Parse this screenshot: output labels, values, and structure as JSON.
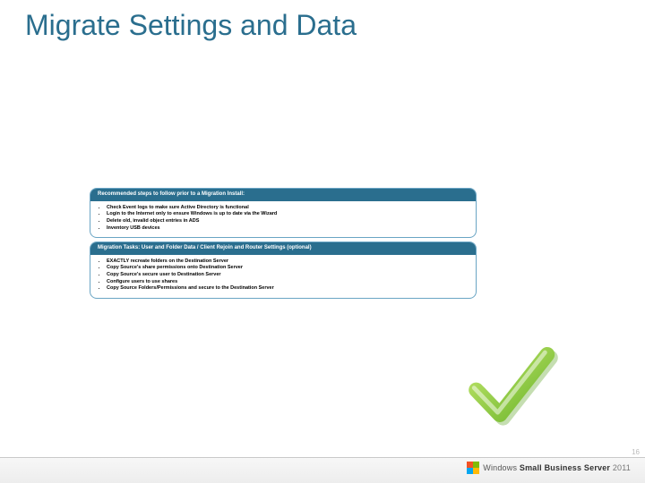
{
  "title": "Migrate Settings and Data",
  "card1": {
    "header": "Recommended steps to follow prior to a Migration Install:",
    "items": [
      "Check Event logs to make sure Active Directory is functional",
      "Login to the Internet only to ensure Windows is up to date via the Wizard",
      "Delete old, invalid object entries in ADS",
      "Inventory USB devices"
    ]
  },
  "card2": {
    "header": "Migration Tasks: User and Folder Data / Client Rejoin and Router Settings (optional)",
    "items": [
      "EXACTLY recreate folders on the Destination Server",
      "Copy Source's share permissions onto Destination Server",
      "Copy Source's secure user to Destination Server",
      "Configure users to use shares",
      "Copy Source Folders/Permissions and secure to the Destination Server"
    ]
  },
  "footer": {
    "brand_windows": "Windows",
    "brand_sbs": "Small Business Server",
    "brand_year": "2011",
    "page": "16"
  }
}
